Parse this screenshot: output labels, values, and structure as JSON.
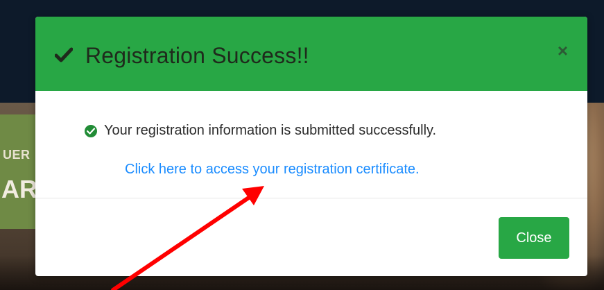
{
  "background": {
    "partial_text_line1": "UER",
    "partial_text_line2": "AR"
  },
  "modal": {
    "title": "Registration Success!!",
    "close_symbol": "×",
    "message": "Your registration information is submitted successfully.",
    "link_text": "Click here to access your registration certificate.",
    "close_button_label": "Close"
  },
  "icons": {
    "title_icon": "checkmark-icon",
    "message_icon": "check-circle-icon",
    "close_icon": "close-icon"
  },
  "colors": {
    "header_bg": "#28a745",
    "link": "#1a8cff",
    "button_bg": "#28a745",
    "annotation_arrow": "#ff0000"
  }
}
